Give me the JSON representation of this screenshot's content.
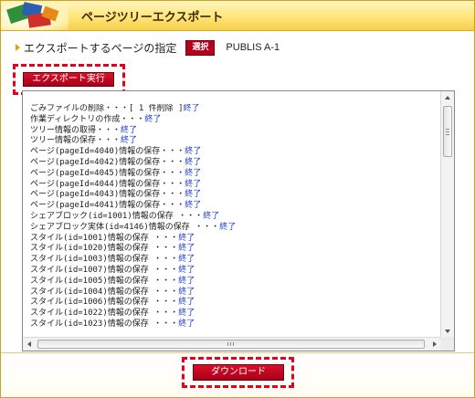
{
  "window": {
    "title": "ページツリーエクスポート"
  },
  "spec": {
    "label": "エクスポートするページの指定",
    "select_label": "選択",
    "value": "PUBLIS A-1"
  },
  "toolbar": {
    "export_label": "エクスポート実行"
  },
  "log": {
    "lines": [
      {
        "text": "ごみファイルの削除・・・[ 1 件削除 ]",
        "status": "終了"
      },
      {
        "text": "作業ディレクトリの作成・・・",
        "status": "終了"
      },
      {
        "text": "ツリー情報の取得・・・",
        "status": "終了"
      },
      {
        "text": "ツリー情報の保存・・・",
        "status": "終了"
      },
      {
        "text": "ページ(pageId=4040)情報の保存・・・",
        "status": "終了"
      },
      {
        "text": "ページ(pageId=4042)情報の保存・・・",
        "status": "終了"
      },
      {
        "text": "ページ(pageId=4045)情報の保存・・・",
        "status": "終了"
      },
      {
        "text": "ページ(pageId=4044)情報の保存・・・",
        "status": "終了"
      },
      {
        "text": "ページ(pageId=4043)情報の保存・・・",
        "status": "終了"
      },
      {
        "text": "ページ(pageId=4041)情報の保存・・・",
        "status": "終了"
      },
      {
        "text": "シェアブロック(id=1001)情報の保存 ・・・",
        "status": "終了"
      },
      {
        "text": "シェアブロック実体(id=4146)情報の保存 ・・・",
        "status": "終了"
      },
      {
        "text": "スタイル(id=1001)情報の保存 ・・・",
        "status": "終了"
      },
      {
        "text": "スタイル(id=1020)情報の保存 ・・・",
        "status": "終了"
      },
      {
        "text": "スタイル(id=1003)情報の保存 ・・・",
        "status": "終了"
      },
      {
        "text": "スタイル(id=1007)情報の保存 ・・・",
        "status": "終了"
      },
      {
        "text": "スタイル(id=1005)情報の保存 ・・・",
        "status": "終了"
      },
      {
        "text": "スタイル(id=1004)情報の保存 ・・・",
        "status": "終了"
      },
      {
        "text": "スタイル(id=1006)情報の保存 ・・・",
        "status": "終了"
      },
      {
        "text": "スタイル(id=1022)情報の保存 ・・・",
        "status": "終了"
      },
      {
        "text": "スタイル(id=1023)情報の保存 ・・・",
        "status": "終了"
      }
    ]
  },
  "footer": {
    "download_label": "ダウンロード"
  },
  "colors": {
    "accent_red": "#b5001d",
    "title_gold": "#ffe57a",
    "status_blue": "#1f3dcc",
    "highlight_red": "#e8001b"
  }
}
